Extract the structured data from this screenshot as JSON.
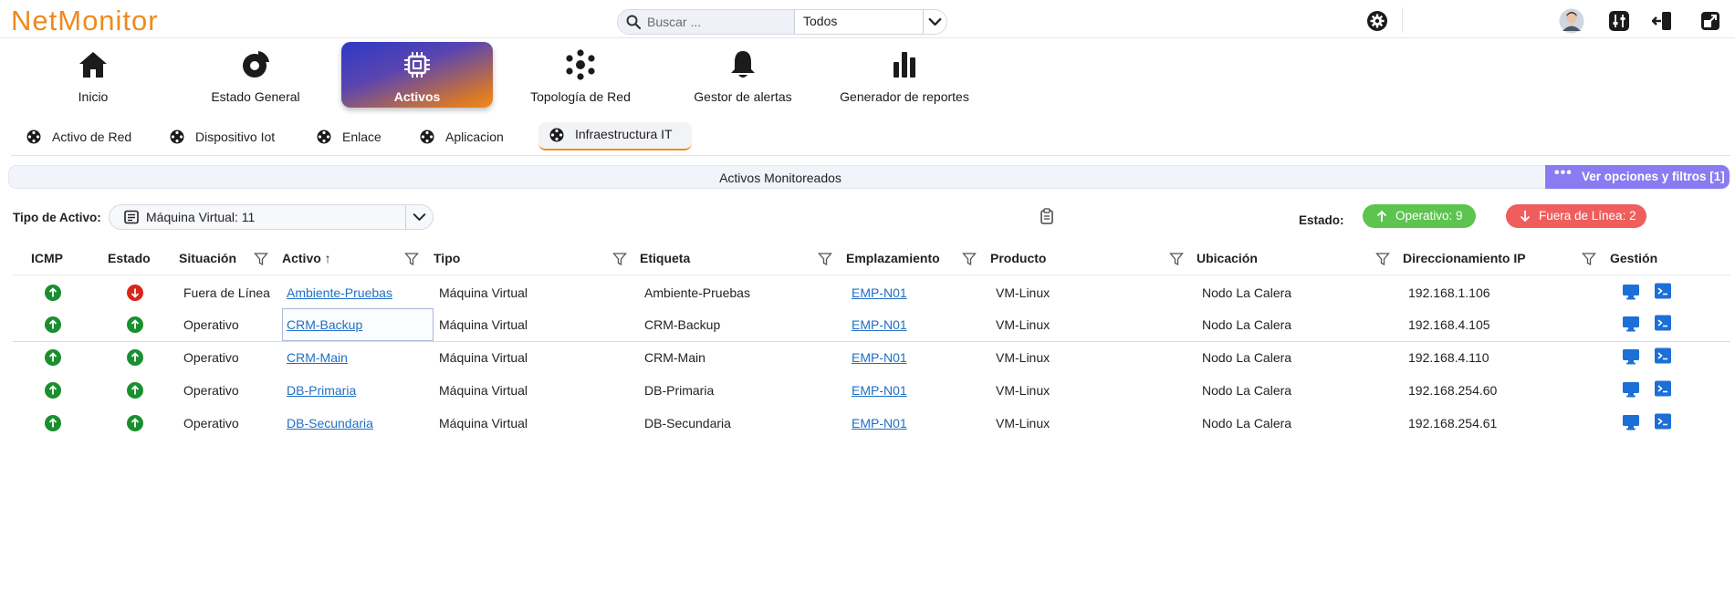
{
  "app": {
    "logo": "NetMonitor"
  },
  "search": {
    "placeholder": "Buscar ...",
    "scope": "Todos"
  },
  "topbar_icons": [
    "gear-icon",
    "avatar",
    "settings-sliders-icon",
    "logout-icon",
    "external-window-icon"
  ],
  "nav": {
    "items": [
      {
        "label": "Inicio",
        "icon": "home-icon"
      },
      {
        "label": "Estado General",
        "icon": "pie-chart-icon"
      },
      {
        "label": "Activos",
        "icon": "chip-icon",
        "active": true
      },
      {
        "label": "Topología de Red",
        "icon": "network-icon"
      },
      {
        "label": "Gestor de alertas",
        "icon": "bell-icon"
      },
      {
        "label": "Generador de reportes",
        "icon": "bar-chart-icon"
      }
    ]
  },
  "subtabs": {
    "items": [
      {
        "label": "Activo de Red"
      },
      {
        "label": "Dispositivo Iot"
      },
      {
        "label": "Enlace"
      },
      {
        "label": "Aplicacion"
      },
      {
        "label": "Infraestructura IT",
        "active": true
      }
    ]
  },
  "section": {
    "title": "Activos Monitoreados",
    "filters_button": "Ver opciones y filtros [1]"
  },
  "filter": {
    "label": "Tipo de Activo:",
    "value": "Máquina Virtual: 11"
  },
  "status": {
    "label": "Estado:",
    "ok": "Operativo: 9",
    "down": "Fuera de Línea: 2"
  },
  "colors": {
    "accent_orange": "#ef8a1e",
    "ok_green": "#5cc44f",
    "down_red": "#f05d5d",
    "link_blue": "#1f6fc5",
    "filters_purple": "#8b7bf2",
    "icmp_green": "#1a8f2f",
    "estado_red": "#d9261c"
  },
  "table": {
    "headers": {
      "icmp": "ICMP",
      "estado": "Estado",
      "situacion": "Situación",
      "activo": "Activo ↑",
      "tipo": "Tipo",
      "etiqueta": "Etiqueta",
      "emplazamiento": "Emplazamiento",
      "producto": "Producto",
      "ubicacion": "Ubicación",
      "ip": "Direccionamiento IP",
      "gestion": "Gestión"
    },
    "rows": [
      {
        "icmp": "up",
        "estado": "down",
        "situacion": "Fuera de Línea",
        "activo": "Ambiente-Pruebas",
        "tipo": "Máquina Virtual",
        "etiqueta": "Ambiente-Pruebas",
        "emplazamiento": "EMP-N01",
        "producto": "VM-Linux",
        "ubicacion": "Nodo La Calera",
        "ip": "192.168.1.106"
      },
      {
        "icmp": "up",
        "estado": "up",
        "situacion": "Operativo",
        "activo": "CRM-Backup",
        "tipo": "Máquina Virtual",
        "etiqueta": "CRM-Backup",
        "emplazamiento": "EMP-N01",
        "producto": "VM-Linux",
        "ubicacion": "Nodo La Calera",
        "ip": "192.168.4.105"
      },
      {
        "icmp": "up",
        "estado": "up",
        "situacion": "Operativo",
        "activo": "CRM-Main",
        "tipo": "Máquina Virtual",
        "etiqueta": "CRM-Main",
        "emplazamiento": "EMP-N01",
        "producto": "VM-Linux",
        "ubicacion": "Nodo La Calera",
        "ip": "192.168.4.110"
      },
      {
        "icmp": "up",
        "estado": "up",
        "situacion": "Operativo",
        "activo": "DB-Primaria",
        "tipo": "Máquina Virtual",
        "etiqueta": "DB-Primaria",
        "emplazamiento": "EMP-N01",
        "producto": "VM-Linux",
        "ubicacion": "Nodo La Calera",
        "ip": "192.168.254.60"
      },
      {
        "icmp": "up",
        "estado": "up",
        "situacion": "Operativo",
        "activo": "DB-Secundaria",
        "tipo": "Máquina Virtual",
        "etiqueta": "DB-Secundaria",
        "emplazamiento": "EMP-N01",
        "producto": "VM-Linux",
        "ubicacion": "Nodo La Calera",
        "ip": "192.168.254.61"
      }
    ]
  }
}
